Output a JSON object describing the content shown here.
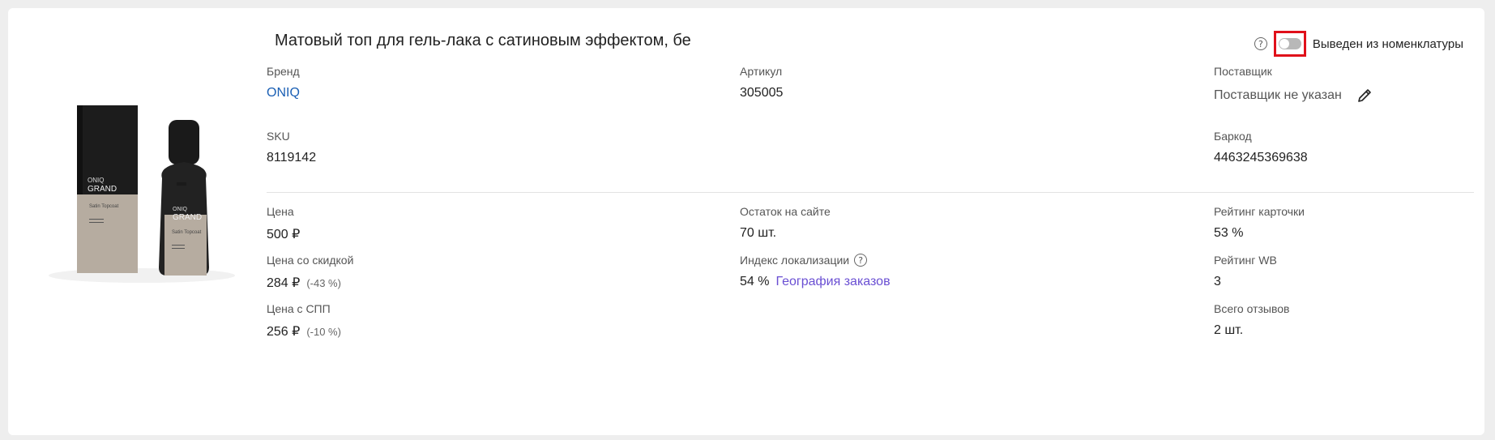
{
  "product": {
    "title": "Матовый топ для гель-лака с сатиновым эффектом, бе",
    "image_brand_line1": "ONIQ",
    "image_brand_line2": "GRAND",
    "image_caption": "Satin Topcoat"
  },
  "toggle": {
    "label": "Выведен из номенклатуры",
    "checked": false,
    "help_icon": "question-circle-icon"
  },
  "info": {
    "brand_label": "Бренд",
    "brand_value": "ONIQ",
    "article_label": "Артикул",
    "article_value": "305005",
    "supplier_label": "Поставщик",
    "supplier_value": "Поставщик не указан",
    "sku_label": "SKU",
    "sku_value": "8119142",
    "barcode_label": "Баркод",
    "barcode_value": "4463245369638"
  },
  "stats": {
    "price_label": "Цена",
    "price_value": "500 ₽",
    "discount_price_label": "Цена со скидкой",
    "discount_price_value": "284 ₽",
    "discount_pct": "(-43 %)",
    "spp_price_label": "Цена с СПП",
    "spp_price_value": "256 ₽",
    "spp_pct": "(-10 %)",
    "stock_label": "Остаток на сайте",
    "stock_value": "70 шт.",
    "localization_label": "Индекс локализации",
    "localization_value": "54 %",
    "geo_link": "География заказов",
    "card_rating_label": "Рейтинг карточки",
    "card_rating_value": "53 %",
    "wb_rating_label": "Рейтинг WB",
    "wb_rating_value": "3",
    "reviews_label": "Всего отзывов",
    "reviews_value": "2 шт."
  },
  "colors": {
    "link": "#1a5fb4",
    "purple_link": "#6a4fd3",
    "highlight": "#e0101a"
  }
}
